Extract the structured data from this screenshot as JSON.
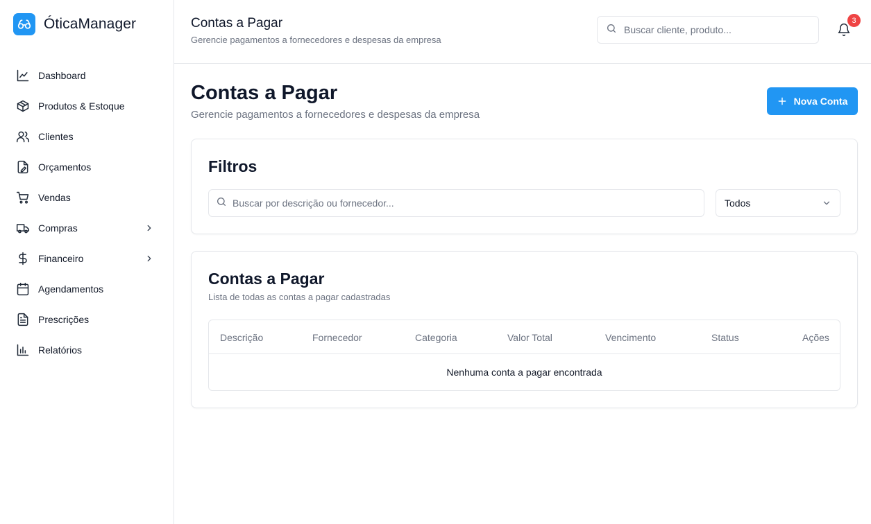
{
  "brand": {
    "name": "ÓticaManager",
    "logo_icon": "glasses-icon",
    "accent": "#2196f3"
  },
  "sidebar": {
    "items": [
      {
        "label": "Dashboard",
        "icon": "line-chart-icon",
        "has_submenu": false
      },
      {
        "label": "Produtos & Estoque",
        "icon": "package-icon",
        "has_submenu": false
      },
      {
        "label": "Clientes",
        "icon": "users-icon",
        "has_submenu": false
      },
      {
        "label": "Orçamentos",
        "icon": "file-edit-icon",
        "has_submenu": false
      },
      {
        "label": "Vendas",
        "icon": "shopping-cart-icon",
        "has_submenu": false
      },
      {
        "label": "Compras",
        "icon": "truck-icon",
        "has_submenu": true
      },
      {
        "label": "Financeiro",
        "icon": "dollar-icon",
        "has_submenu": true
      },
      {
        "label": "Agendamentos",
        "icon": "calendar-icon",
        "has_submenu": false
      },
      {
        "label": "Prescrições",
        "icon": "file-text-icon",
        "has_submenu": false
      },
      {
        "label": "Relatórios",
        "icon": "bar-chart-icon",
        "has_submenu": false
      }
    ]
  },
  "header": {
    "title": "Contas a Pagar",
    "subtitle": "Gerencie pagamentos a fornecedores e despesas da empresa",
    "search_placeholder": "Buscar cliente, produto...",
    "notifications_count": "3",
    "badge_color": "#ef4444"
  },
  "page": {
    "title": "Contas a Pagar",
    "subtitle": "Gerencie pagamentos a fornecedores e despesas da empresa",
    "new_button_label": "Nova Conta"
  },
  "filters": {
    "title": "Filtros",
    "search_placeholder": "Buscar por descrição ou fornecedor...",
    "status_selected": "Todos"
  },
  "list": {
    "title": "Contas a Pagar",
    "subtitle": "Lista de todas as contas a pagar cadastradas",
    "columns": [
      "Descrição",
      "Fornecedor",
      "Categoria",
      "Valor Total",
      "Vencimento",
      "Status",
      "Ações"
    ],
    "empty_message": "Nenhuma conta a pagar encontrada"
  }
}
